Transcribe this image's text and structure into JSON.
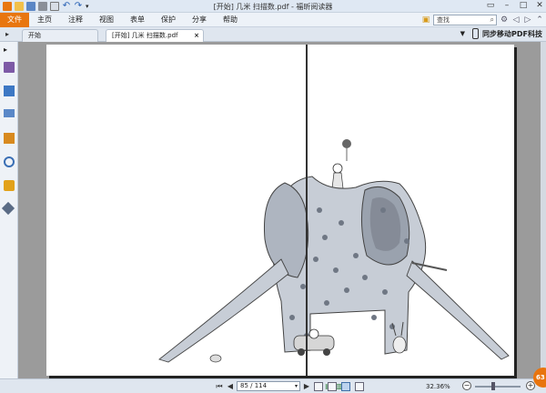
{
  "window": {
    "title": "[开始] 几米 扫描数.pdf - 福昕阅读器"
  },
  "menu": {
    "file": "文件",
    "items": [
      "主页",
      "注释",
      "视图",
      "表单",
      "保护",
      "分享",
      "帮助"
    ]
  },
  "search": {
    "placeholder": "查找"
  },
  "tabs": [
    {
      "label": "开始"
    },
    {
      "label": "[开始] 几米 扫描数.pdf"
    }
  ],
  "sync_label": "同步移动PDF科技",
  "status": {
    "page_value": "85 / 114",
    "zoom": "32.36%",
    "badge": "63"
  },
  "colors": {
    "accent": "#e8760f",
    "page_bg": "#ffffff",
    "canvas_bg": "#9b9b9b"
  }
}
